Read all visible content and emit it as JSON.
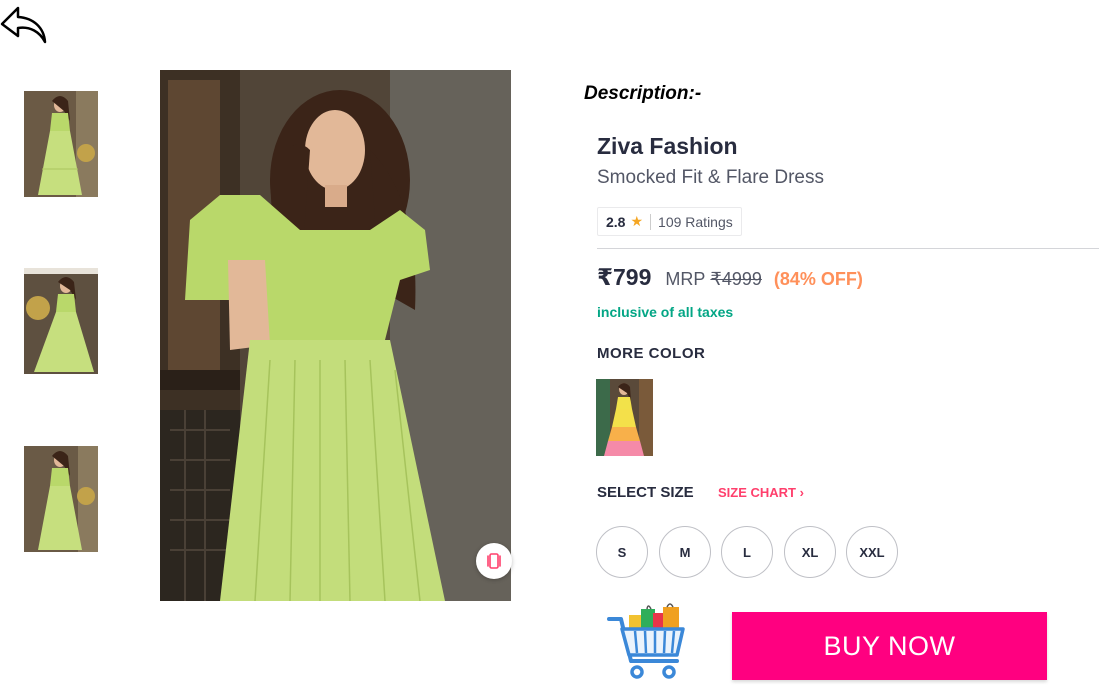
{
  "icons": {
    "back": "back-arrow-icon",
    "similar": "similar-products-icon",
    "star": "star-icon",
    "cart": "shopping-cart-icon",
    "chevron": "chevron-right-icon"
  },
  "description_heading": "Description:-",
  "product": {
    "brand": "Ziva Fashion",
    "name": "Smocked Fit & Flare Dress",
    "rating": "2.8",
    "star": "★",
    "ratings_count": "109 Ratings",
    "price": "₹799",
    "mrp_label": "MRP",
    "mrp": "₹4999",
    "discount": "(84% OFF)",
    "tax_note": "inclusive of all taxes"
  },
  "more_color": {
    "title": "MORE COLOR"
  },
  "size": {
    "title": "SELECT SIZE",
    "chart_label": "SIZE CHART",
    "chevron": "›",
    "options": [
      "S",
      "M",
      "L",
      "XL",
      "XXL"
    ]
  },
  "actions": {
    "buy_now": "BUY NOW"
  },
  "colors": {
    "accent": "#ff0080",
    "discount": "#ff905a",
    "tax_green": "#03a685",
    "size_chart_pink": "#ff3f6c",
    "dress_green": "#b9d86a"
  }
}
